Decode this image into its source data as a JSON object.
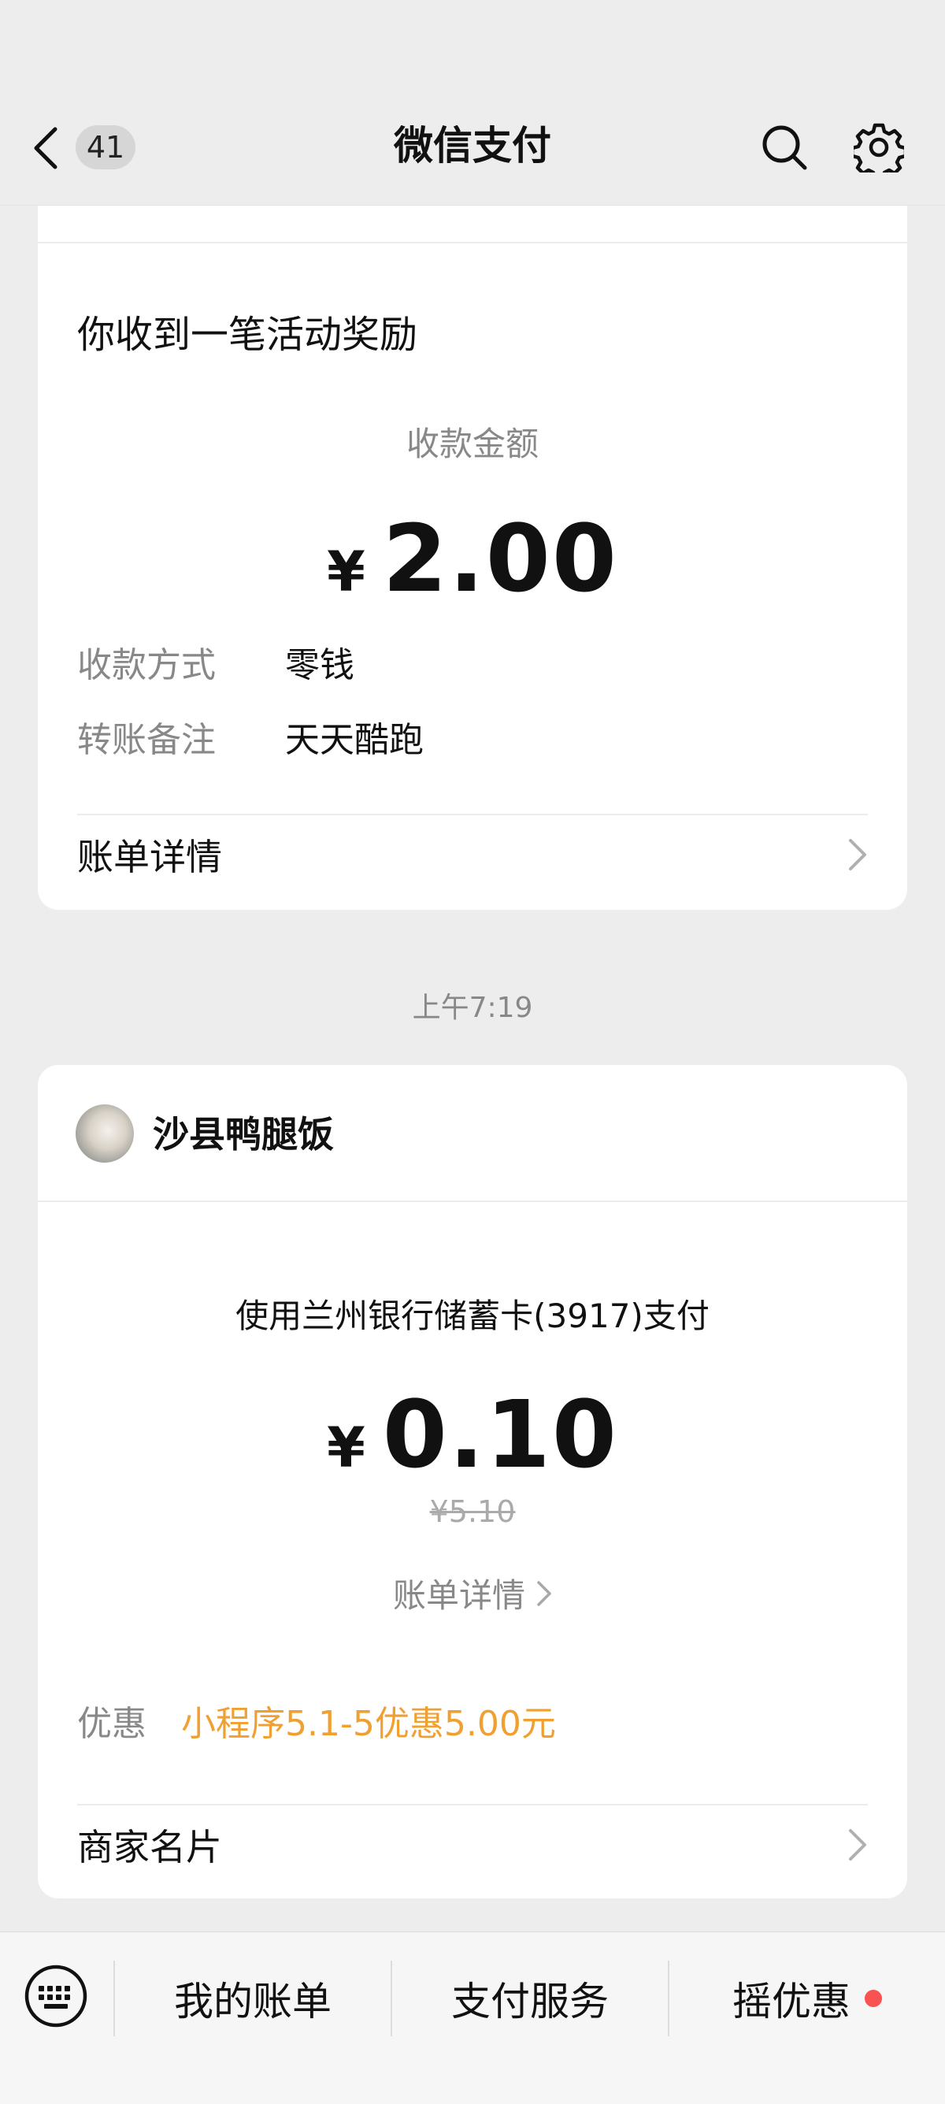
{
  "header": {
    "back_badge": "41",
    "title": "微信支付"
  },
  "card1": {
    "heading": "你收到一笔活动奖励",
    "amount_label": "收款金额",
    "currency": "¥",
    "amount": "2.00",
    "method_label": "收款方式",
    "method_value": "零钱",
    "remark_label": "转账备注",
    "remark_value": "天天酷跑",
    "details_link": "账单详情"
  },
  "timestamp": "上午7:19",
  "card2": {
    "merchant_name": "沙县鸭腿饭",
    "payment_method": "使用兰州银行储蓄卡(3917)支付",
    "currency": "¥",
    "amount": "0.10",
    "original_price": "¥5.10",
    "details_link": "账单详情",
    "discount_label": "优惠",
    "discount_value": "小程序5.1-5优惠5.00元",
    "merchant_card_link": "商家名片"
  },
  "bottom_bar": {
    "items": [
      {
        "label": "我的账单"
      },
      {
        "label": "支付服务"
      },
      {
        "label": "摇优惠",
        "has_dot": true
      }
    ]
  },
  "colors": {
    "discount": "#f0a030",
    "notification_dot": "#fa5151",
    "background": "#ededed"
  }
}
